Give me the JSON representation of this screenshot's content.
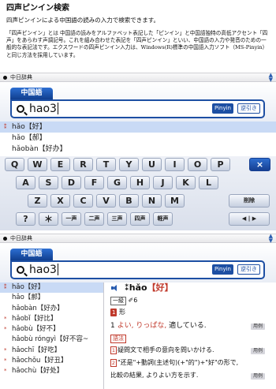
{
  "doc": {
    "title": "四声ピンイン検索",
    "subtitle": "四声ピンインによる中国語の読みの入力で検索できます。",
    "body": "「四声ピンイン」とは 中国語の読みをアルファベット表記した「ピンイン」と中国語独特の高低アクセント「四声」をあらわす声調記号。これを組み合わせた表記を「四声ピンイン」といい、中国語の入力や発音のための一般的な表記法です。エクスワードの四声ピンイン入力は、Windows(R)標準の中国語入力ソフト（MS-Pinyin）と同じ方法を採用しています。"
  },
  "panel": {
    "title": "中日辞典",
    "tab_label": "中国語",
    "search_value": "hao3",
    "pinyin_label": "Pinyin",
    "reverse_label": "逆引き"
  },
  "results_top": [
    {
      "mark": "⁑",
      "text": "hǎo【好】",
      "selected": true
    },
    {
      "mark": "",
      "text": "hǎo【郝】",
      "selected": false
    },
    {
      "mark": "",
      "text": "hǎobàn【好办】",
      "selected": false
    }
  ],
  "keyboard": {
    "row1": [
      "Q",
      "W",
      "E",
      "R",
      "T",
      "Y",
      "U",
      "I",
      "O",
      "P"
    ],
    "row2": [
      "A",
      "S",
      "D",
      "F",
      "G",
      "H",
      "J",
      "K",
      "L"
    ],
    "row3": [
      "Z",
      "X",
      "C",
      "V",
      "B",
      "N",
      "M"
    ],
    "row4": [
      "?",
      "＊",
      "一声",
      "二声",
      "三声",
      "四声",
      "軽声"
    ],
    "close_label": "×",
    "delete_label": "削除",
    "arrows_label": "◀ | ▶"
  },
  "results_bottom": [
    {
      "mark": "⁑",
      "text": "hǎo【好】",
      "selected": true
    },
    {
      "mark": "",
      "text": "hǎo【郝】",
      "selected": false
    },
    {
      "mark": "",
      "text": "hǎobàn【好办】",
      "selected": false
    },
    {
      "mark": "*",
      "text": "hǎobǐ【好比】",
      "selected": false
    },
    {
      "mark": "*",
      "text": "hǎobù【好不】",
      "selected": false
    },
    {
      "mark": "",
      "text": "hǎobù róngyì【好不容~",
      "selected": false
    },
    {
      "mark": "*",
      "text": "hǎochī【好吃】",
      "selected": false
    },
    {
      "mark": "*",
      "text": "hǎochǒu【好丑】",
      "selected": false
    },
    {
      "mark": "*",
      "text": "hǎochù【好处】",
      "selected": false
    }
  ],
  "entry": {
    "headword_py": "⁑hǎo",
    "headword_hz": "【好】",
    "level": "一級",
    "strokes": "✐6",
    "pos_num": "1",
    "pos": "形",
    "sense_num": "1",
    "sense_red": "よい, りっぱな,",
    "sense_rest": "適している.",
    "example_btn": "用例",
    "grammar_label": "語法",
    "sub1_num": "1",
    "sub1_text": "疑問文で相手の意向を問いかける.",
    "sub2_num": "2",
    "sub2_text": "\"还是\"+動詞(主述句)(+\"的\")+\"好\"の形で,",
    "sub3_text": "比較の結果, よりよい方を示す."
  }
}
